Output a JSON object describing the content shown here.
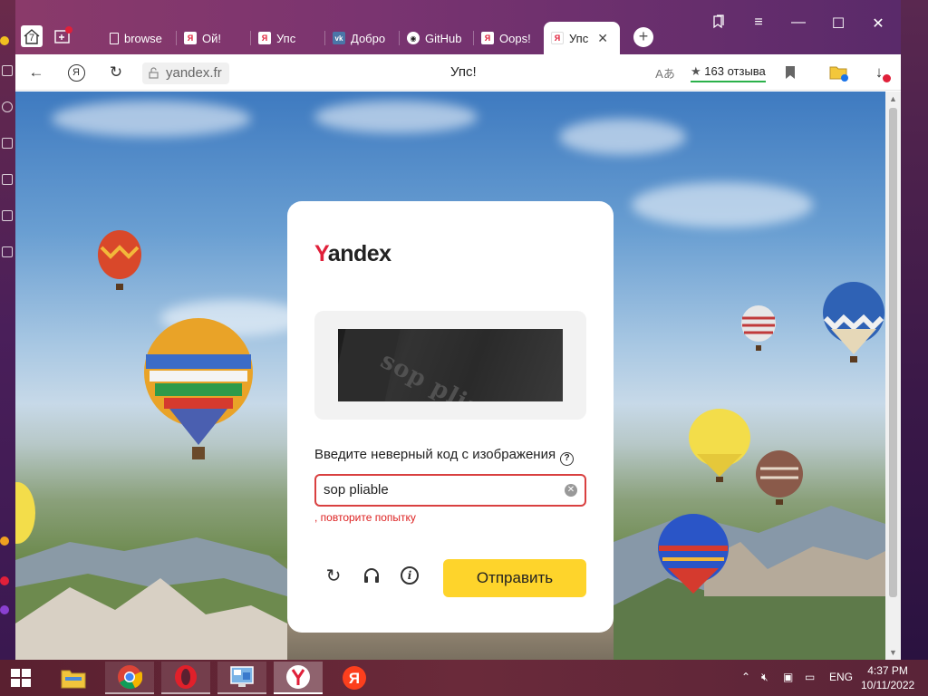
{
  "tabs": [
    {
      "label": "browse",
      "icon": "doc-icon"
    },
    {
      "label": "Ой!",
      "icon": "yandex-icon"
    },
    {
      "label": "Упс",
      "icon": "yandex-icon"
    },
    {
      "label": "Добро",
      "icon": "vk-icon"
    },
    {
      "label": "GitHub",
      "icon": "github-icon"
    },
    {
      "label": "Oops!",
      "icon": "yandex-icon"
    },
    {
      "label": "Упс",
      "icon": "yandex-icon",
      "active": true
    }
  ],
  "home_count": "7",
  "address": {
    "url": "yandex.fr",
    "page_title": "Упс!",
    "reviews": "163 отзыва"
  },
  "card": {
    "logo_y": "Y",
    "logo_rest": "andex",
    "captcha_text": "sop pliable",
    "prompt": "Введите неверный код с изображения",
    "input_value": "sop pliable",
    "error": ", повторите попытку",
    "submit": "Отправить"
  },
  "taskbar": {
    "lang": "ENG",
    "time": "4:37 PM",
    "date": "10/11/2022"
  },
  "colors": {
    "yandex_red": "#e0203a",
    "submit_yellow": "#fed42b",
    "error_red": "#d94040"
  }
}
